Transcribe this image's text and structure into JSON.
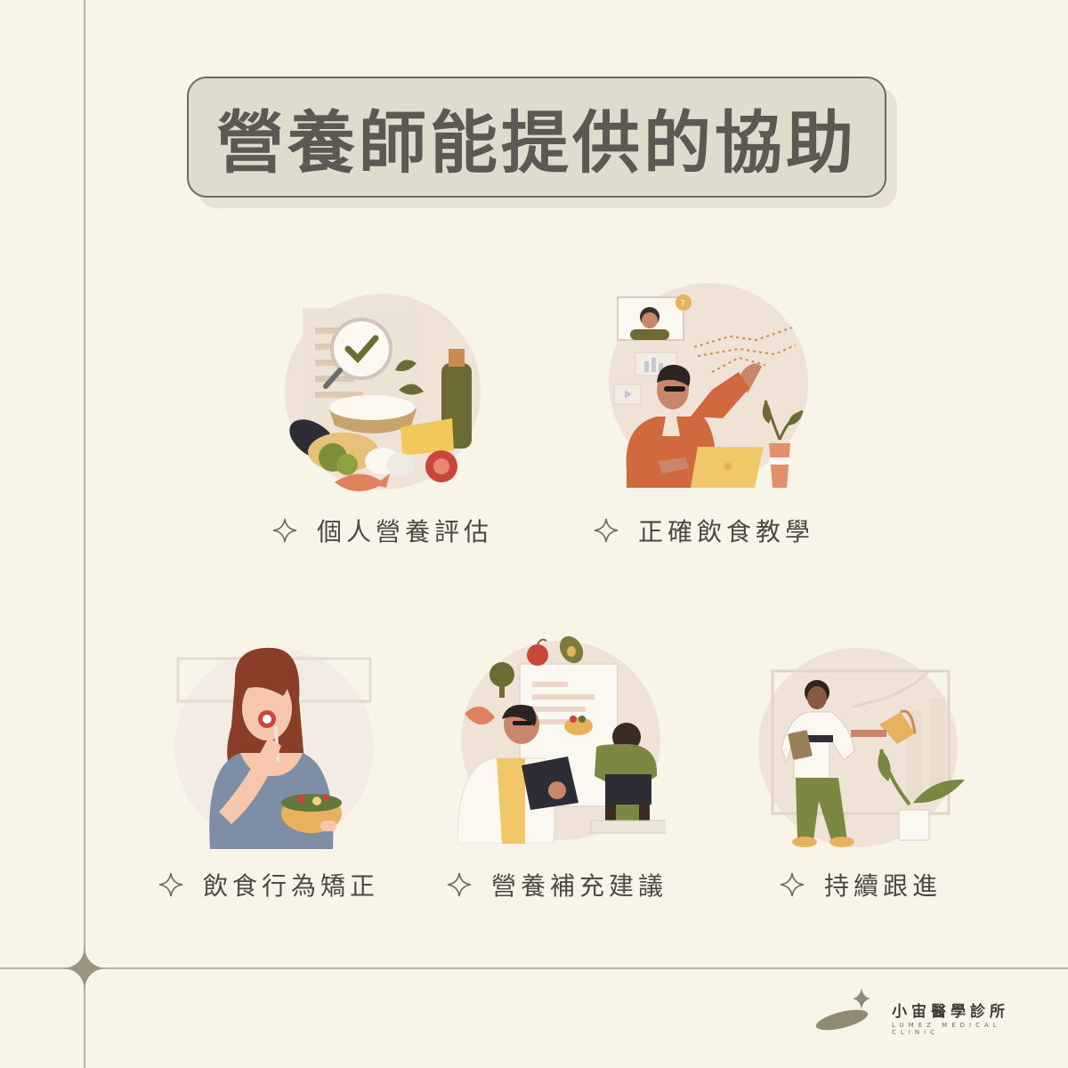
{
  "title": "營養師能提供的協助",
  "services": [
    {
      "label": "個人營養評估",
      "icon": "food-assessment-illustration"
    },
    {
      "label": "正確飲食教學",
      "icon": "online-teaching-illustration"
    },
    {
      "label": "飲食行為矯正",
      "icon": "woman-eating-salad-illustration"
    },
    {
      "label": "營養補充建議",
      "icon": "dietitian-consultation-illustration"
    },
    {
      "label": "持續跟進",
      "icon": "progress-tracking-illustration"
    }
  ],
  "brand": {
    "name": "小宙醫學診所",
    "subtitle": "LUMEZ MEDICAL CLINIC"
  },
  "colors": {
    "background": "#f8f4e7",
    "title_box": "#e0dccd",
    "line": "#b9b3a2",
    "text": "#4a4a44",
    "olive": "#7c7a3c",
    "orange": "#c9633a"
  }
}
